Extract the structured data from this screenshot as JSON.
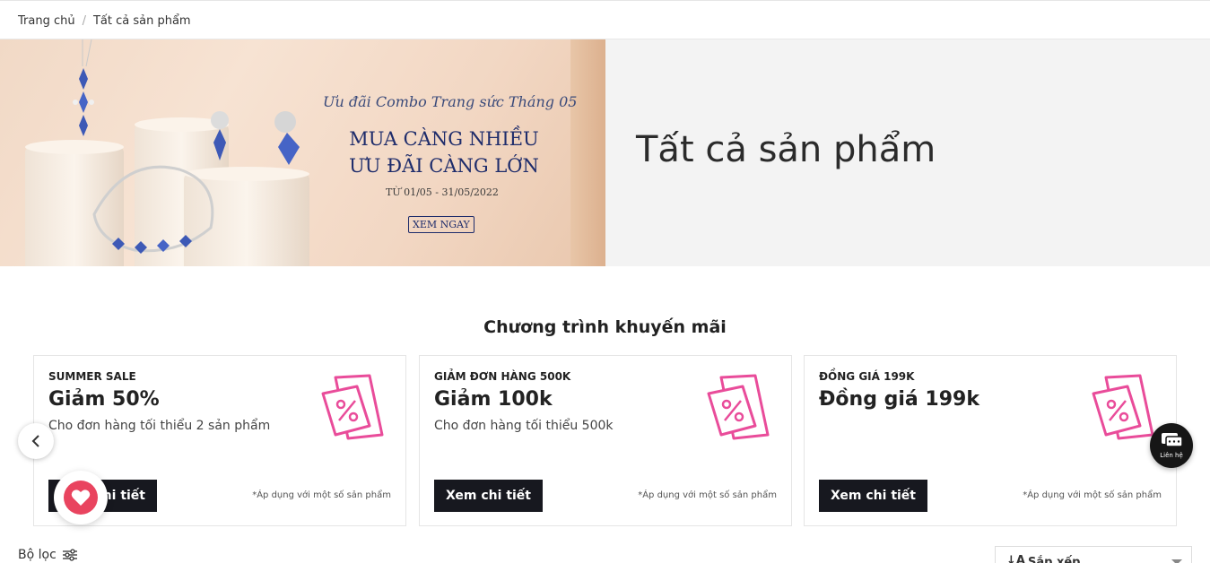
{
  "breadcrumb": {
    "home": "Trang chủ",
    "separator": "/",
    "current": "Tất cả sản phẩm"
  },
  "hero": {
    "title": "Tất cả sản phẩm",
    "banner": {
      "script_text": "Ưu đãi Combo Trang sức Tháng 05",
      "headline_line1": "MUA CÀNG NHIỀU",
      "headline_line2": "ƯU ĐÃI CÀNG LỚN",
      "date_range": "TỪ 01/05 - 31/05/2022",
      "cta": "XEM NGAY"
    }
  },
  "promotions": {
    "title": "Chương trình khuyến mãi",
    "cards": [
      {
        "tag": "SUMMER SALE",
        "heading": "Giảm 50%",
        "desc": "Cho đơn hàng tối thiểu 2 sản phẩm",
        "button": "Xem chi tiết",
        "note": "*Áp dụng với một số sản phẩm",
        "icon": "coupon-percent-icon"
      },
      {
        "tag": "GIẢM ĐƠN HÀNG 500K",
        "heading": "Giảm 100k",
        "desc": "Cho đơn hàng tối thiểu 500k",
        "button": "Xem chi tiết",
        "note": "*Áp dụng với một số sản phẩm",
        "icon": "coupon-percent-icon"
      },
      {
        "tag": "ĐỒNG GIÁ 199K",
        "heading": "Đồng giá 199k",
        "desc": "",
        "button": "Xem chi tiết",
        "note": "*Áp dụng với một số sản phẩm",
        "icon": "coupon-percent-icon"
      }
    ]
  },
  "floating": {
    "chat_label": "Liên hệ"
  },
  "toolbar": {
    "filter_label": "Bộ lọc",
    "sort_label": "Sắp xếp"
  },
  "colors": {
    "accent_pink": "#e94c9a",
    "button_dark": "#17181f",
    "heart_red": "#e9445f",
    "banner_navy": "#1e2c6b"
  }
}
